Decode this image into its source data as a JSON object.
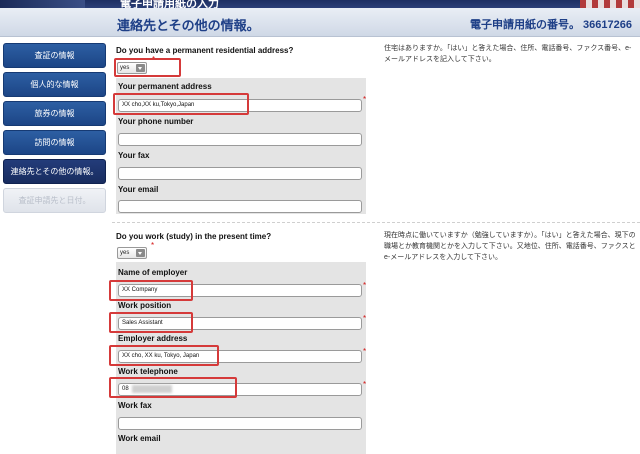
{
  "app": {
    "top_title": "電子申請用紙の入力",
    "page_title": "連絡先とその他の情報。",
    "form_number": "電子申請用紙の番号。 36617266"
  },
  "sidebar": {
    "items": [
      {
        "label": "査証の情報",
        "state": "normal"
      },
      {
        "label": "個人的な情報",
        "state": "normal"
      },
      {
        "label": "旅券の情報",
        "state": "normal"
      },
      {
        "label": "訪問の情報",
        "state": "normal"
      },
      {
        "label": "連絡先とその他の情報。",
        "state": "active"
      },
      {
        "label": "査証申請先と日付。",
        "state": "disabled"
      }
    ]
  },
  "residence": {
    "question": "Do you have a permanent residential address?",
    "answer": "yes",
    "help": "住宅はありますか。「はい」と答えた場合、住所、電話番号、ファクス番号、e-メールアドレスを記入して下さい。",
    "fields": {
      "address_label": "Your permanent address",
      "address_value": "XX cho,XX ku,Tokyo,Japan",
      "phone_label": "Your phone number",
      "phone_value": "",
      "fax_label": "Your fax",
      "fax_value": "",
      "email_label": "Your email",
      "email_value": ""
    }
  },
  "work": {
    "question": "Do you work (study) in the present time?",
    "answer": "yes",
    "help": "現在時点に働いていますか（勉強していますか）。「はい」と答えた場合、現下の職場とか教育機関とかを入力して下さい。又地位、住所、電話番号、ファクスとe-メールアドレスを入力して下さい。",
    "fields": {
      "employer_label": "Name of employer",
      "employer_value": "XX Company",
      "position_label": "Work position",
      "position_value": "Sales Assistant",
      "address_label": "Employer address",
      "address_value": "XX cho, XX ku, Tokyo, Japan",
      "telephone_label": "Work telephone",
      "telephone_value": "08",
      "fax_label": "Work fax",
      "fax_value": "",
      "email_label": "Work email",
      "email_value": ""
    }
  },
  "colors": {
    "nav_blue": "#1c4586",
    "nav_active": "#182c5f",
    "title_blue": "#1e3f87",
    "required_red": "#d31414",
    "highlight_red": "#d53a3a"
  }
}
